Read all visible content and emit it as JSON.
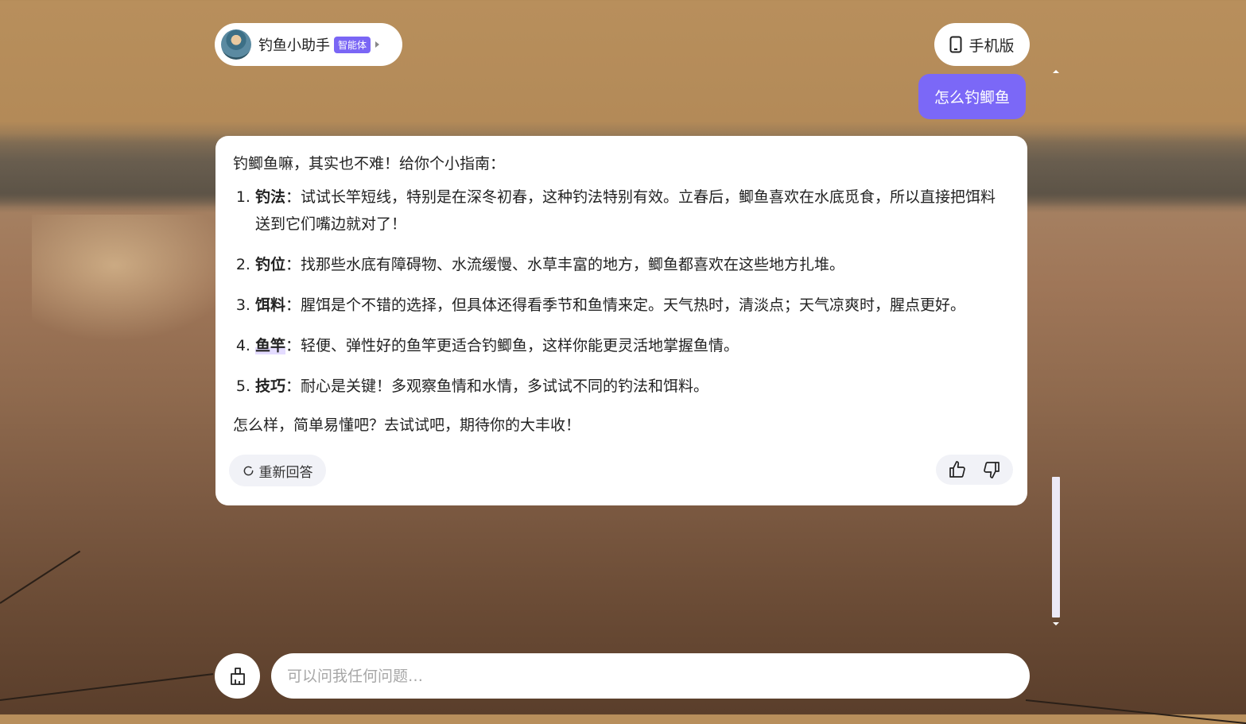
{
  "agent": {
    "name": "钓鱼小助手",
    "badge": "智能体"
  },
  "mobile_button": {
    "label": "手机版",
    "icon": "phone-icon"
  },
  "conversation": {
    "user_message": "怎么钓鲫鱼",
    "answer": {
      "intro": "钓鲫鱼嘛，其实也不难！给你个小指南：",
      "items": [
        {
          "title": "钓法",
          "text": "：试试长竿短线，特别是在深冬初春，这种钓法特别有效。立春后，鲫鱼喜欢在水底觅食，所以直接把饵料送到它们嘴边就对了！"
        },
        {
          "title": "钓位",
          "text": "：找那些水底有障碍物、水流缓慢、水草丰富的地方，鲫鱼都喜欢在这些地方扎堆。"
        },
        {
          "title": "饵料",
          "text": "：腥饵是个不错的选择，但具体还得看季节和鱼情来定。天气热时，清淡点；天气凉爽时，腥点更好。"
        },
        {
          "title": "鱼竿",
          "text": "：轻便、弹性好的鱼竿更适合钓鲫鱼，这样你能更灵活地掌握鱼情。"
        },
        {
          "title": "技巧",
          "text": "：耐心是关键！多观察鱼情和水情，多试试不同的钓法和饵料。"
        }
      ],
      "outro": "怎么样，简单易懂吧？去试试吧，期待你的大丰收！",
      "regenerate_label": "重新回答"
    }
  },
  "input": {
    "placeholder": "可以问我任何问题…"
  },
  "colors": {
    "accent": "#7b68f7",
    "badge": "#7a66f5"
  }
}
